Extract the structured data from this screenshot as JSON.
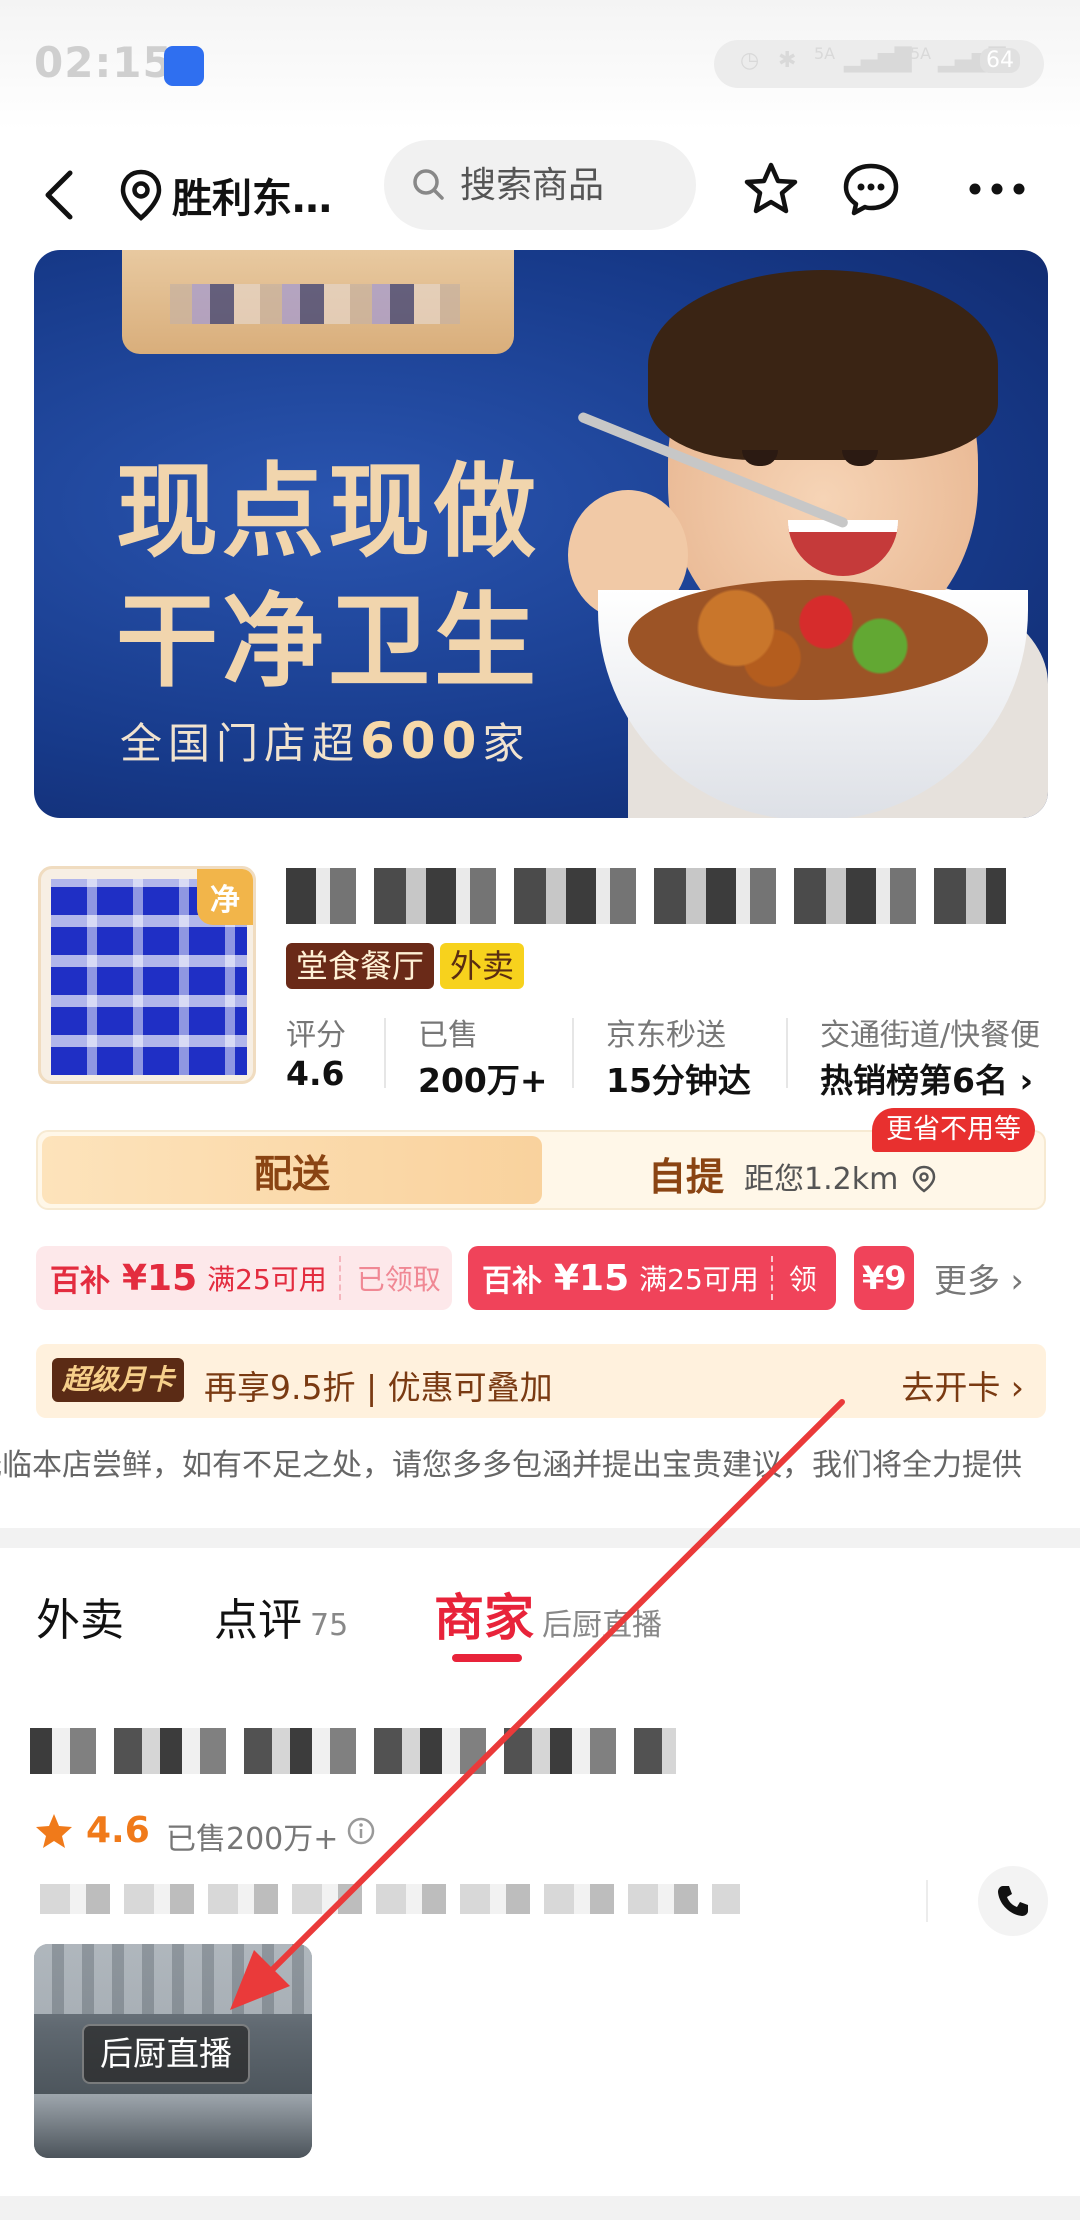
{
  "status_bar": {
    "time": "02:15",
    "battery": "64",
    "network": [
      "5A",
      "5A"
    ]
  },
  "nav": {
    "location": "胜利东…",
    "search_placeholder": "搜索商品"
  },
  "banner": {
    "line1": "现点现做",
    "line2": "干净卫生",
    "sub_prefix": "全国门店超",
    "sub_number": "600",
    "sub_suffix": "家"
  },
  "store": {
    "logo_badge": "净",
    "tags": [
      "堂食餐厅",
      "外卖"
    ],
    "stats": [
      {
        "label": "评分",
        "value": "4.6"
      },
      {
        "label": "已售",
        "value": "200万+"
      },
      {
        "label": "京东秒送",
        "value": "15分钟达"
      },
      {
        "label": "交通街道/快餐便",
        "value": "热销榜第6名 ›"
      }
    ]
  },
  "mode": {
    "delivery": "配送",
    "pickup": "自提",
    "distance": "距您1.2km",
    "save_badge": "更省不用等"
  },
  "coupons": [
    {
      "name": "百补",
      "amount": "¥15",
      "condition": "满25可用",
      "action": "已领取"
    },
    {
      "name": "百补",
      "amount": "¥15",
      "condition": "满25可用",
      "action": "领"
    },
    {
      "amount": "¥9"
    }
  ],
  "coupons_more": "更多 ›",
  "member": {
    "tag": "超级月卡",
    "text": "再享9.5折 | 优惠可叠加",
    "cta": "去开卡 ›"
  },
  "notice": "光临本店尝鲜，如有不足之处，请您多多包涵并提出宝贵建议，我们将全力提供",
  "tabs": [
    {
      "label": "外卖"
    },
    {
      "label": "点评",
      "count": "75"
    },
    {
      "label": "商家",
      "sub": "后厨直播"
    }
  ],
  "merchant": {
    "rating": "4.6",
    "sold": "已售200万+",
    "live_label": "后厨直播"
  },
  "colors": {
    "accent_red": "#e8233a",
    "brand_orange": "#f07a1a",
    "banner_blue": "#173a8a"
  }
}
